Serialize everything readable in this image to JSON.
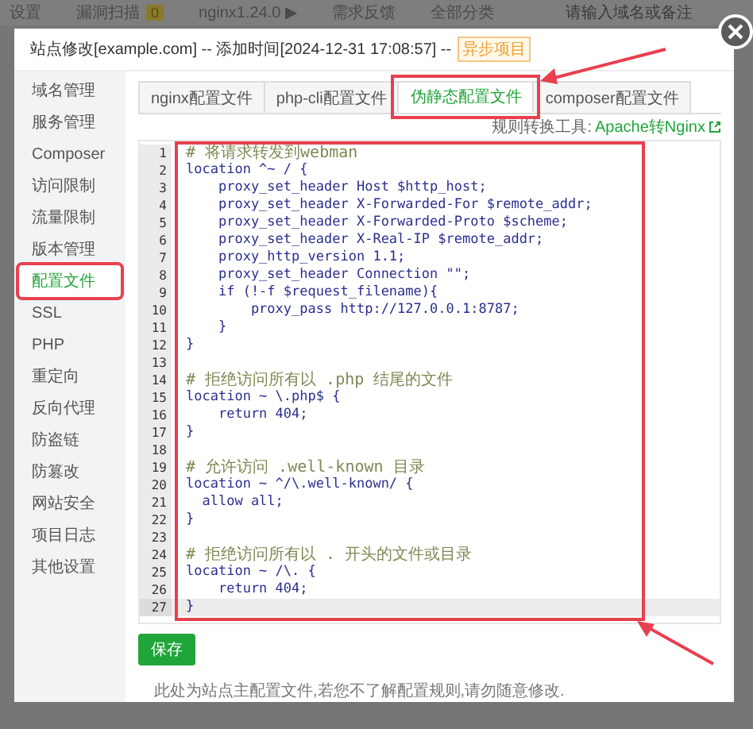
{
  "background_bar": {
    "items": [
      {
        "label": "设置",
        "kind": "text"
      },
      {
        "label": "漏洞扫描",
        "kind": "text"
      },
      {
        "label": "0",
        "kind": "badge"
      },
      {
        "label": "nginx1.24.0 ▶",
        "kind": "text"
      },
      {
        "label": "需求反馈",
        "kind": "text"
      },
      {
        "label": "全部分类",
        "kind": "text"
      }
    ],
    "search": {
      "placeholder": "请输入域名或备注"
    }
  },
  "dialog": {
    "title": "站点修改[example.com] -- 添加时间[2024-12-31 17:08:57] --",
    "badge": "异步项目"
  },
  "sidebar": {
    "items": [
      {
        "label": "域名管理",
        "selected": false,
        "highlighted": false
      },
      {
        "label": "服务管理",
        "selected": false,
        "highlighted": false
      },
      {
        "label": "Composer",
        "selected": false,
        "highlighted": false
      },
      {
        "label": "访问限制",
        "selected": false,
        "highlighted": false
      },
      {
        "label": "流量限制",
        "selected": false,
        "highlighted": false
      },
      {
        "label": "版本管理",
        "selected": false,
        "highlighted": false
      },
      {
        "label": "配置文件",
        "selected": true,
        "highlighted": true
      },
      {
        "label": "SSL",
        "selected": false,
        "highlighted": false
      },
      {
        "label": "PHP",
        "selected": false,
        "highlighted": false
      },
      {
        "label": "重定向",
        "selected": false,
        "highlighted": false
      },
      {
        "label": "反向代理",
        "selected": false,
        "highlighted": false
      },
      {
        "label": "防盗链",
        "selected": false,
        "highlighted": false
      },
      {
        "label": "防篡改",
        "selected": false,
        "highlighted": false
      },
      {
        "label": "网站安全",
        "selected": false,
        "highlighted": false
      },
      {
        "label": "项目日志",
        "selected": false,
        "highlighted": false
      },
      {
        "label": "其他设置",
        "selected": false,
        "highlighted": false
      }
    ]
  },
  "tabs": [
    {
      "label": "nginx配置文件",
      "selected": false,
      "highlighted": false
    },
    {
      "label": "php-cli配置文件",
      "selected": false,
      "highlighted": false
    },
    {
      "label": "伪静态配置文件",
      "selected": true,
      "highlighted": true
    },
    {
      "label": "composer配置文件",
      "selected": false,
      "highlighted": false
    }
  ],
  "rule_tool": {
    "label": "规则转换工具:",
    "link": "Apache转Nginx"
  },
  "editor": {
    "highlighted": true,
    "lines": [
      {
        "number": "1",
        "kind": "comment",
        "text": "# 将请求转发到webman",
        "active": false
      },
      {
        "number": "2",
        "kind": "code",
        "text": "location ^~ / {",
        "active": false
      },
      {
        "number": "3",
        "kind": "code",
        "text": "    proxy_set_header Host $http_host;",
        "active": false
      },
      {
        "number": "4",
        "kind": "code",
        "text": "    proxy_set_header X-Forwarded-For $remote_addr;",
        "active": false
      },
      {
        "number": "5",
        "kind": "code",
        "text": "    proxy_set_header X-Forwarded-Proto $scheme;",
        "active": false
      },
      {
        "number": "6",
        "kind": "code",
        "text": "    proxy_set_header X-Real-IP $remote_addr;",
        "active": false
      },
      {
        "number": "7",
        "kind": "code",
        "text": "    proxy_http_version 1.1;",
        "active": false
      },
      {
        "number": "8",
        "kind": "code",
        "text": "    proxy_set_header Connection \"\";",
        "active": false
      },
      {
        "number": "9",
        "kind": "code",
        "text": "    if (!-f $request_filename){",
        "active": false
      },
      {
        "number": "10",
        "kind": "code",
        "text": "        proxy_pass http://127.0.0.1:8787;",
        "active": false
      },
      {
        "number": "11",
        "kind": "code",
        "text": "    }",
        "active": false
      },
      {
        "number": "12",
        "kind": "code",
        "text": "}",
        "active": false
      },
      {
        "number": "13",
        "kind": "blank",
        "active": false
      },
      {
        "number": "14",
        "kind": "comment",
        "text": "# 拒绝访问所有以 .php 结尾的文件",
        "active": false
      },
      {
        "number": "15",
        "kind": "code",
        "text": "location ~ \\.php$ {",
        "active": false
      },
      {
        "number": "16",
        "kind": "code",
        "text": "    return 404;",
        "active": false
      },
      {
        "number": "17",
        "kind": "code",
        "text": "}",
        "active": false
      },
      {
        "number": "18",
        "kind": "blank",
        "active": false
      },
      {
        "number": "19",
        "kind": "comment",
        "text": "# 允许访问 .well-known 目录",
        "active": false
      },
      {
        "number": "20",
        "kind": "code",
        "text": "location ~ ^/\\.well-known/ {",
        "active": false
      },
      {
        "number": "21",
        "kind": "code",
        "text": "  allow all;",
        "active": false
      },
      {
        "number": "22",
        "kind": "code",
        "text": "}",
        "active": false
      },
      {
        "number": "23",
        "kind": "blank",
        "active": false
      },
      {
        "number": "24",
        "kind": "comment",
        "text": "# 拒绝访问所有以 . 开头的文件或目录",
        "active": false
      },
      {
        "number": "25",
        "kind": "code",
        "text": "location ~ /\\. {",
        "active": false
      },
      {
        "number": "26",
        "kind": "code",
        "text": "    return 404;",
        "active": false
      },
      {
        "number": "27",
        "kind": "code",
        "text": "}",
        "active": true
      }
    ]
  },
  "save_button": "保存",
  "note": "此处为站点主配置文件,若您不了解配置规则,请勿随意修改."
}
